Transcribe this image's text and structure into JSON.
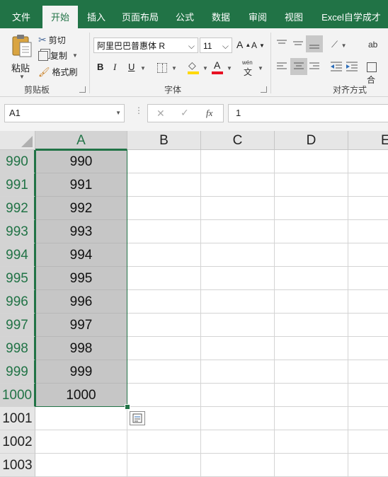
{
  "tabs": [
    {
      "label": "文件",
      "active": false
    },
    {
      "label": "开始",
      "active": true
    },
    {
      "label": "插入",
      "active": false
    },
    {
      "label": "页面布局",
      "active": false
    },
    {
      "label": "公式",
      "active": false
    },
    {
      "label": "数据",
      "active": false
    },
    {
      "label": "审阅",
      "active": false
    },
    {
      "label": "视图",
      "active": false
    },
    {
      "label": "Excel自学成才",
      "active": false
    }
  ],
  "clipboard": {
    "paste": "粘贴",
    "cut": "剪切",
    "copy": "复制",
    "format_painter": "格式刷",
    "group": "剪贴板"
  },
  "font": {
    "name": "阿里巴巴普惠体 R",
    "size": "11",
    "grow": "A",
    "shrink": "A",
    "bold": "B",
    "italic": "I",
    "underline": "U",
    "font_color_letter": "A",
    "phonetic": "wén",
    "phonetic_char": "文",
    "group": "字体"
  },
  "alignment": {
    "group": "对齐方式",
    "wrap_char": "ab",
    "merge_char": "合"
  },
  "formula_bar": {
    "name_box": "A1",
    "fx": "fx",
    "value": "1"
  },
  "columns": [
    "A",
    "B",
    "C",
    "D",
    "E"
  ],
  "rows": [
    {
      "num": "990",
      "a": "990",
      "selected": true
    },
    {
      "num": "991",
      "a": "991",
      "selected": true
    },
    {
      "num": "992",
      "a": "992",
      "selected": true
    },
    {
      "num": "993",
      "a": "993",
      "selected": true
    },
    {
      "num": "994",
      "a": "994",
      "selected": true
    },
    {
      "num": "995",
      "a": "995",
      "selected": true
    },
    {
      "num": "996",
      "a": "996",
      "selected": true
    },
    {
      "num": "997",
      "a": "997",
      "selected": true
    },
    {
      "num": "998",
      "a": "998",
      "selected": true
    },
    {
      "num": "999",
      "a": "999",
      "selected": true
    },
    {
      "num": "1000",
      "a": "1000",
      "selected": true
    },
    {
      "num": "1001",
      "a": "",
      "selected": false
    },
    {
      "num": "1002",
      "a": "",
      "selected": false
    },
    {
      "num": "1003",
      "a": "",
      "selected": false
    }
  ],
  "colors": {
    "accent": "#217346",
    "selection": "#c6c6c6",
    "font_color_bar": "#e81123",
    "fill_color_bar": "#ffd800"
  }
}
